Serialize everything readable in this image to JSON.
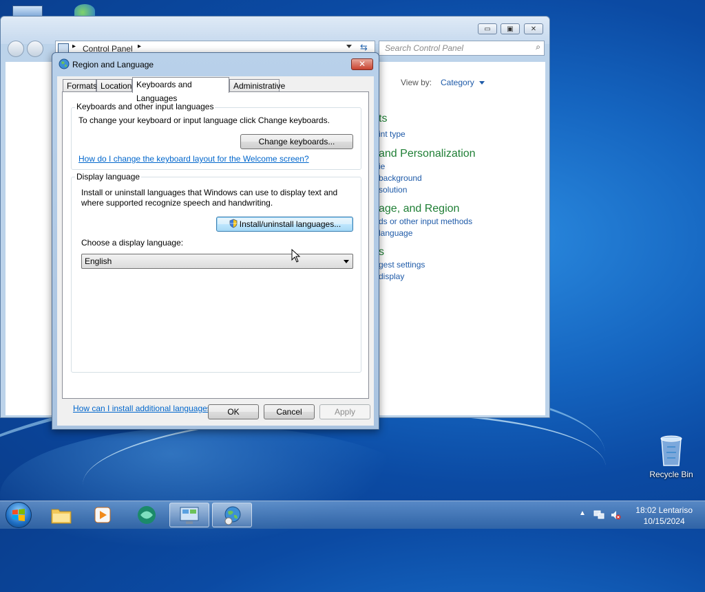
{
  "desktop": {
    "recycle_bin_label": "Recycle Bin"
  },
  "control_panel": {
    "address_text": "Control Panel",
    "search_placeholder": "Search Control Panel",
    "view_by_label": "View by:",
    "view_by_value": "Category",
    "categories": [
      {
        "heading": "ts",
        "links": [
          "int type"
        ]
      },
      {
        "heading": "and Personalization",
        "links": [
          "ie",
          "background",
          "solution"
        ]
      },
      {
        "heading": "age, and Region",
        "links": [
          "ds or other input methods",
          "language"
        ]
      },
      {
        "heading": "s",
        "links": [
          "gest settings",
          "display"
        ]
      }
    ]
  },
  "dialog": {
    "title": "Region and Language",
    "tabs": [
      "Formats",
      "Location",
      "Keyboards and Languages",
      "Administrative"
    ],
    "active_tab": "Keyboards and Languages",
    "keyboards_group": {
      "title": "Keyboards and other input languages",
      "description": "To change your keyboard or input language click Change keyboards.",
      "button": "Change keyboards...",
      "link": "How do I change the keyboard layout for the Welcome screen?"
    },
    "display_group": {
      "title": "Display language",
      "description_line1": "Install or uninstall languages that Windows can use to display text and",
      "description_line2": "where supported recognize speech and handwriting.",
      "button": "Install/uninstall languages...",
      "choose_label": "Choose a display language:",
      "selected_language": "English"
    },
    "bottom_link": "How can I install additional languages?",
    "ok": "OK",
    "cancel": "Cancel",
    "apply": "Apply"
  },
  "taskbar": {
    "clock_time": "18:02 Lentariso",
    "clock_date": "10/15/2024"
  }
}
